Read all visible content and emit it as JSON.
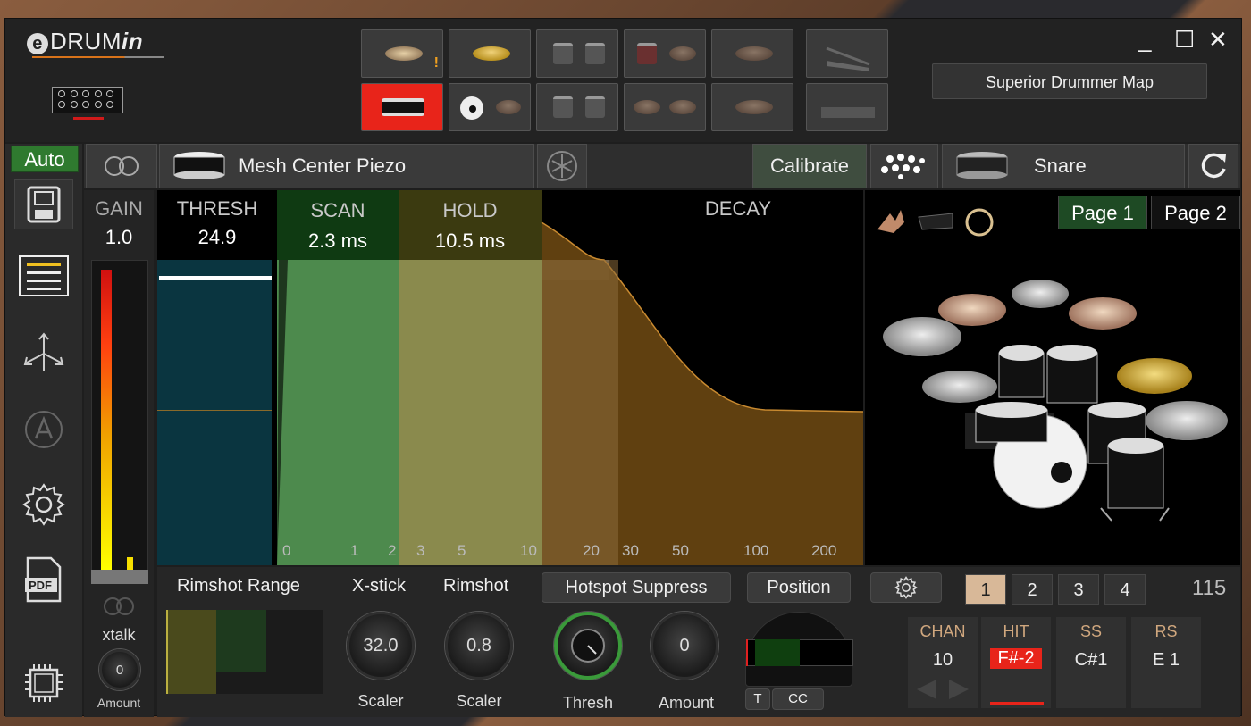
{
  "app": {
    "logo_prefix": "DRUM",
    "logo_suffix": "in"
  },
  "toolbar": {
    "map_label": "Superior Drummer Map"
  },
  "window_controls": {
    "minimize": "_",
    "maximize": "☐",
    "close": "✕"
  },
  "sidebar": {
    "auto_label": "Auto",
    "xtalk_label": "xtalk",
    "xtalk_amount_value": "0",
    "xtalk_amount_label": "Amount"
  },
  "strip": {
    "pad_name": "Mesh Center Piezo",
    "calibrate_label": "Calibrate",
    "instrument_name": "Snare"
  },
  "gain": {
    "label": "GAIN",
    "value": "1.0"
  },
  "thresh": {
    "label": "THRESH",
    "value": "24.9"
  },
  "scan": {
    "label": "SCAN",
    "value": "2.3 ms"
  },
  "hold": {
    "label": "HOLD",
    "value": "10.5 ms"
  },
  "decay": {
    "label": "DECAY"
  },
  "graph_ticks": [
    "0",
    "1",
    "2",
    "3",
    "5",
    "10",
    "20",
    "30",
    "50",
    "100",
    "200"
  ],
  "pages": {
    "page1": "Page 1",
    "page2": "Page 2"
  },
  "bottom": {
    "rimshot_range_label": "Rimshot Range",
    "xstick_label": "X-stick",
    "xstick_value": "32.0",
    "xstick_sub": "Scaler",
    "rimshot_label": "Rimshot",
    "rimshot_value": "0.8",
    "rimshot_sub": "Scaler",
    "hotspot_label": "Hotspot Suppress",
    "hotspot_sub": "Thresh",
    "position_label": "Position",
    "amount_value": "0",
    "amount_sub": "Amount",
    "t_label": "T",
    "cc_label": "CC",
    "tabs": [
      "1",
      "2",
      "3",
      "4"
    ],
    "count": "115"
  },
  "midi": {
    "chan_label": "CHAN",
    "chan_value": "10",
    "hit_label": "HIT",
    "hit_value": "F#-2",
    "ss_label": "SS",
    "ss_value": "C#1",
    "rs_label": "RS",
    "rs_value": "E 1"
  },
  "colors": {
    "selected_pad": "#e8241a",
    "active_green": "#2f7a2f",
    "decay_orange": "#8a5a1a"
  }
}
